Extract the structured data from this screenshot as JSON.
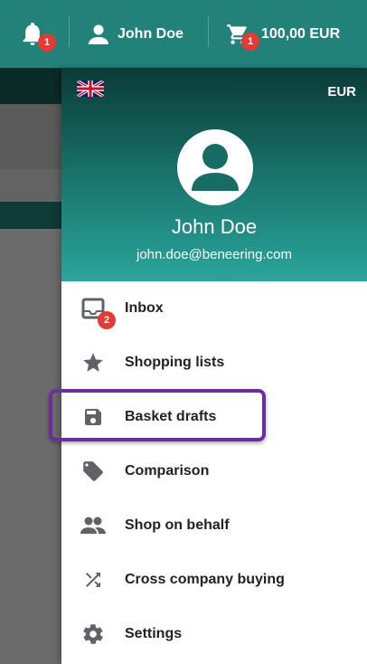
{
  "topbar": {
    "notifications_badge": "1",
    "user_name": "John Doe",
    "cart_badge": "1",
    "cart_total": "100,00 EUR"
  },
  "drawer": {
    "currency": "EUR",
    "user_name": "John Doe",
    "user_email": "john.doe@beneering.com",
    "inbox_badge": "2",
    "menu": [
      {
        "label": "Inbox",
        "icon": "inbox-icon"
      },
      {
        "label": "Shopping lists",
        "icon": "star-icon"
      },
      {
        "label": "Basket drafts",
        "icon": "save-icon"
      },
      {
        "label": "Comparison",
        "icon": "tag-icon"
      },
      {
        "label": "Shop on behalf",
        "icon": "people-icon"
      },
      {
        "label": "Cross company buying",
        "icon": "shuffle-icon"
      },
      {
        "label": "Settings",
        "icon": "gear-icon"
      }
    ]
  },
  "colors": {
    "topbar": "#22827a",
    "badge": "#e53935",
    "highlight": "#6a2f9c",
    "icon": "#5f6368"
  }
}
